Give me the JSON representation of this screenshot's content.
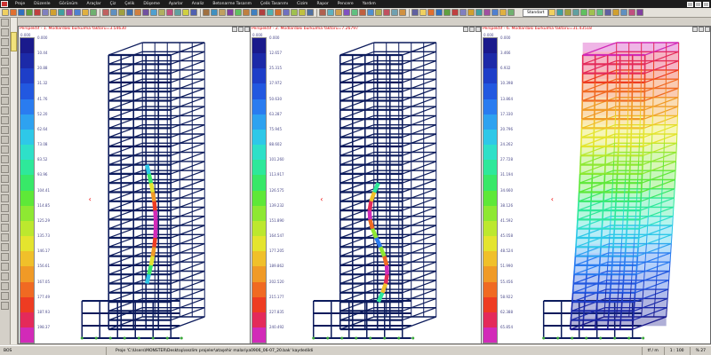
{
  "menu": [
    "Proje",
    "Düzenle",
    "Görünüm",
    "Araçlar",
    "Çiz",
    "Çelik",
    "Döşeme",
    "Ayarlar",
    "Analiz",
    "Betonarme Tasarım",
    "Çelik Tasarımı",
    "Cizim",
    "Rapor",
    "Pencere",
    "Yardım"
  ],
  "toolbar": {
    "standart_tab": "Standart"
  },
  "panels": [
    {
      "title": "Perspektif - 1. Modlardaki burkulma faktörü=3.54630",
      "legend_top": "0.000",
      "legend_values": [
        "0.000",
        "10.44",
        "20.88",
        "31.32",
        "41.76",
        "52.20",
        "62.64",
        "73.08",
        "83.52",
        "93.96",
        "104.41",
        "114.85",
        "125.29",
        "135.73",
        "146.17",
        "156.61",
        "167.05",
        "177.49",
        "187.93",
        "198.37"
      ],
      "colors": [
        "#1a1a8c",
        "#1c2aa8",
        "#1e3ec8",
        "#2258e0",
        "#2a7cf0",
        "#2ea2f0",
        "#2ec8e8",
        "#2ee0c8",
        "#2ee89a",
        "#38e868",
        "#5ee838",
        "#8ee832",
        "#bce82e",
        "#e4e42e",
        "#f0c02a",
        "#f09a26",
        "#f06a22",
        "#ee3c22",
        "#e42a5a",
        "#d22ab8"
      ]
    },
    {
      "title": "Perspektif - 2. Modlardaki burkulma faktörü=7.26797",
      "legend_top": "0.000",
      "legend_values": [
        "0.000",
        "12.657",
        "25.315",
        "37.972",
        "50.630",
        "63.287",
        "75.945",
        "88.602",
        "101.260",
        "113.917",
        "126.575",
        "139.232",
        "151.890",
        "164.547",
        "177.205",
        "189.862",
        "202.520",
        "215.177",
        "227.835",
        "240.492"
      ],
      "colors": [
        "#1a1a8c",
        "#1c2aa8",
        "#1e3ec8",
        "#2258e0",
        "#2a7cf0",
        "#2ea2f0",
        "#2ec8e8",
        "#2ee0c8",
        "#2ee89a",
        "#38e868",
        "#5ee838",
        "#8ee832",
        "#bce82e",
        "#e4e42e",
        "#f0c02a",
        "#f09a26",
        "#f06a22",
        "#ee3c22",
        "#e42a5a",
        "#d22ab8"
      ]
    },
    {
      "title": "Perspektif - 6. Modlardaki burkulma faktörü=31.43518",
      "legend_top": "0.000",
      "legend_values": [
        "0.000",
        "3.466",
        "6.932",
        "10.398",
        "13.864",
        "17.330",
        "20.796",
        "24.262",
        "27.728",
        "31.194",
        "34.660",
        "38.126",
        "41.592",
        "45.058",
        "48.524",
        "51.990",
        "55.456",
        "58.922",
        "62.388",
        "65.854"
      ],
      "colors": [
        "#1a1a8c",
        "#1c2aa8",
        "#1e3ec8",
        "#2258e0",
        "#2a7cf0",
        "#2ea2f0",
        "#2ec8e8",
        "#2ee0c8",
        "#2ee89a",
        "#38e868",
        "#5ee838",
        "#8ee832",
        "#bce82e",
        "#e4e42e",
        "#f0c02a",
        "#f09a26",
        "#f06a22",
        "#ee3c22",
        "#e42a5a",
        "#d22ab8"
      ]
    }
  ],
  "status": {
    "left": "BOS",
    "message": "Proje 'C:\\Users\\MONSTER\\Desktop\\sezlim projeler\\ataşehir malariya0906_06-07_20.bak' kaydedildi",
    "units": "tf / m",
    "scale": "1 : 100",
    "zoom": "% 27"
  }
}
